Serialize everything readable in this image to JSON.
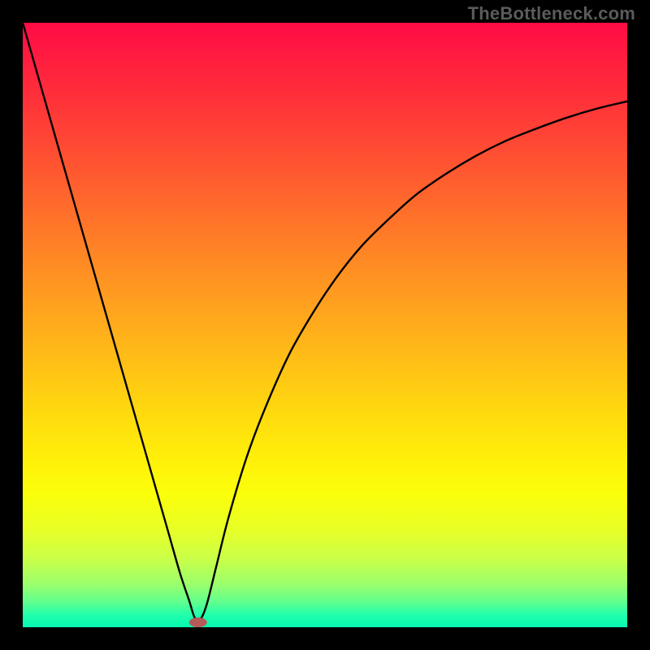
{
  "watermark": "TheBottleneck.com",
  "chart_data": {
    "type": "line",
    "title": "",
    "xlabel": "",
    "ylabel": "",
    "xlim": [
      0,
      100
    ],
    "ylim": [
      0,
      100
    ],
    "series": [
      {
        "name": "curve",
        "x": [
          0,
          2,
          4,
          6,
          8,
          10,
          12,
          14,
          16,
          18,
          20,
          22,
          24,
          26,
          27.5,
          28.5,
          29.5,
          30.5,
          32,
          34,
          37,
          40,
          44,
          48,
          52,
          56,
          60,
          65,
          70,
          75,
          80,
          85,
          90,
          95,
          100
        ],
        "values": [
          100,
          93,
          86,
          79,
          72,
          65,
          58,
          51,
          44,
          37,
          30,
          23,
          16,
          9,
          4.5,
          1.5,
          1.5,
          4,
          10,
          18,
          28,
          36,
          45,
          52,
          58,
          63,
          67,
          71.5,
          75,
          78,
          80.5,
          82.5,
          84.3,
          85.8,
          87
        ]
      }
    ],
    "annotations": [
      {
        "name": "dip-marker",
        "x": 29,
        "y": 0.8
      }
    ]
  }
}
